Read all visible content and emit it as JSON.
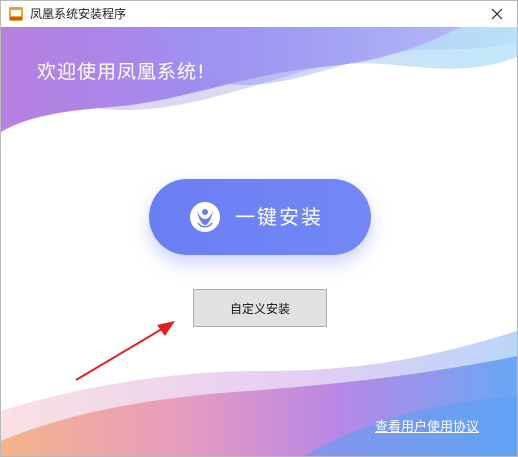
{
  "window": {
    "title": "凤凰系统安装程序",
    "close_symbol": "✕"
  },
  "header": {
    "welcome_text": "欢迎使用凤凰系统!"
  },
  "main": {
    "one_click_label": "一键安装",
    "one_click_icon": "phoenix-logo-icon",
    "custom_install_label": "自定义安装"
  },
  "footer": {
    "agreement_link": "查看用户使用协议"
  },
  "colors": {
    "accent": "#6a7ef4",
    "annotation_arrow": "#e02020"
  }
}
